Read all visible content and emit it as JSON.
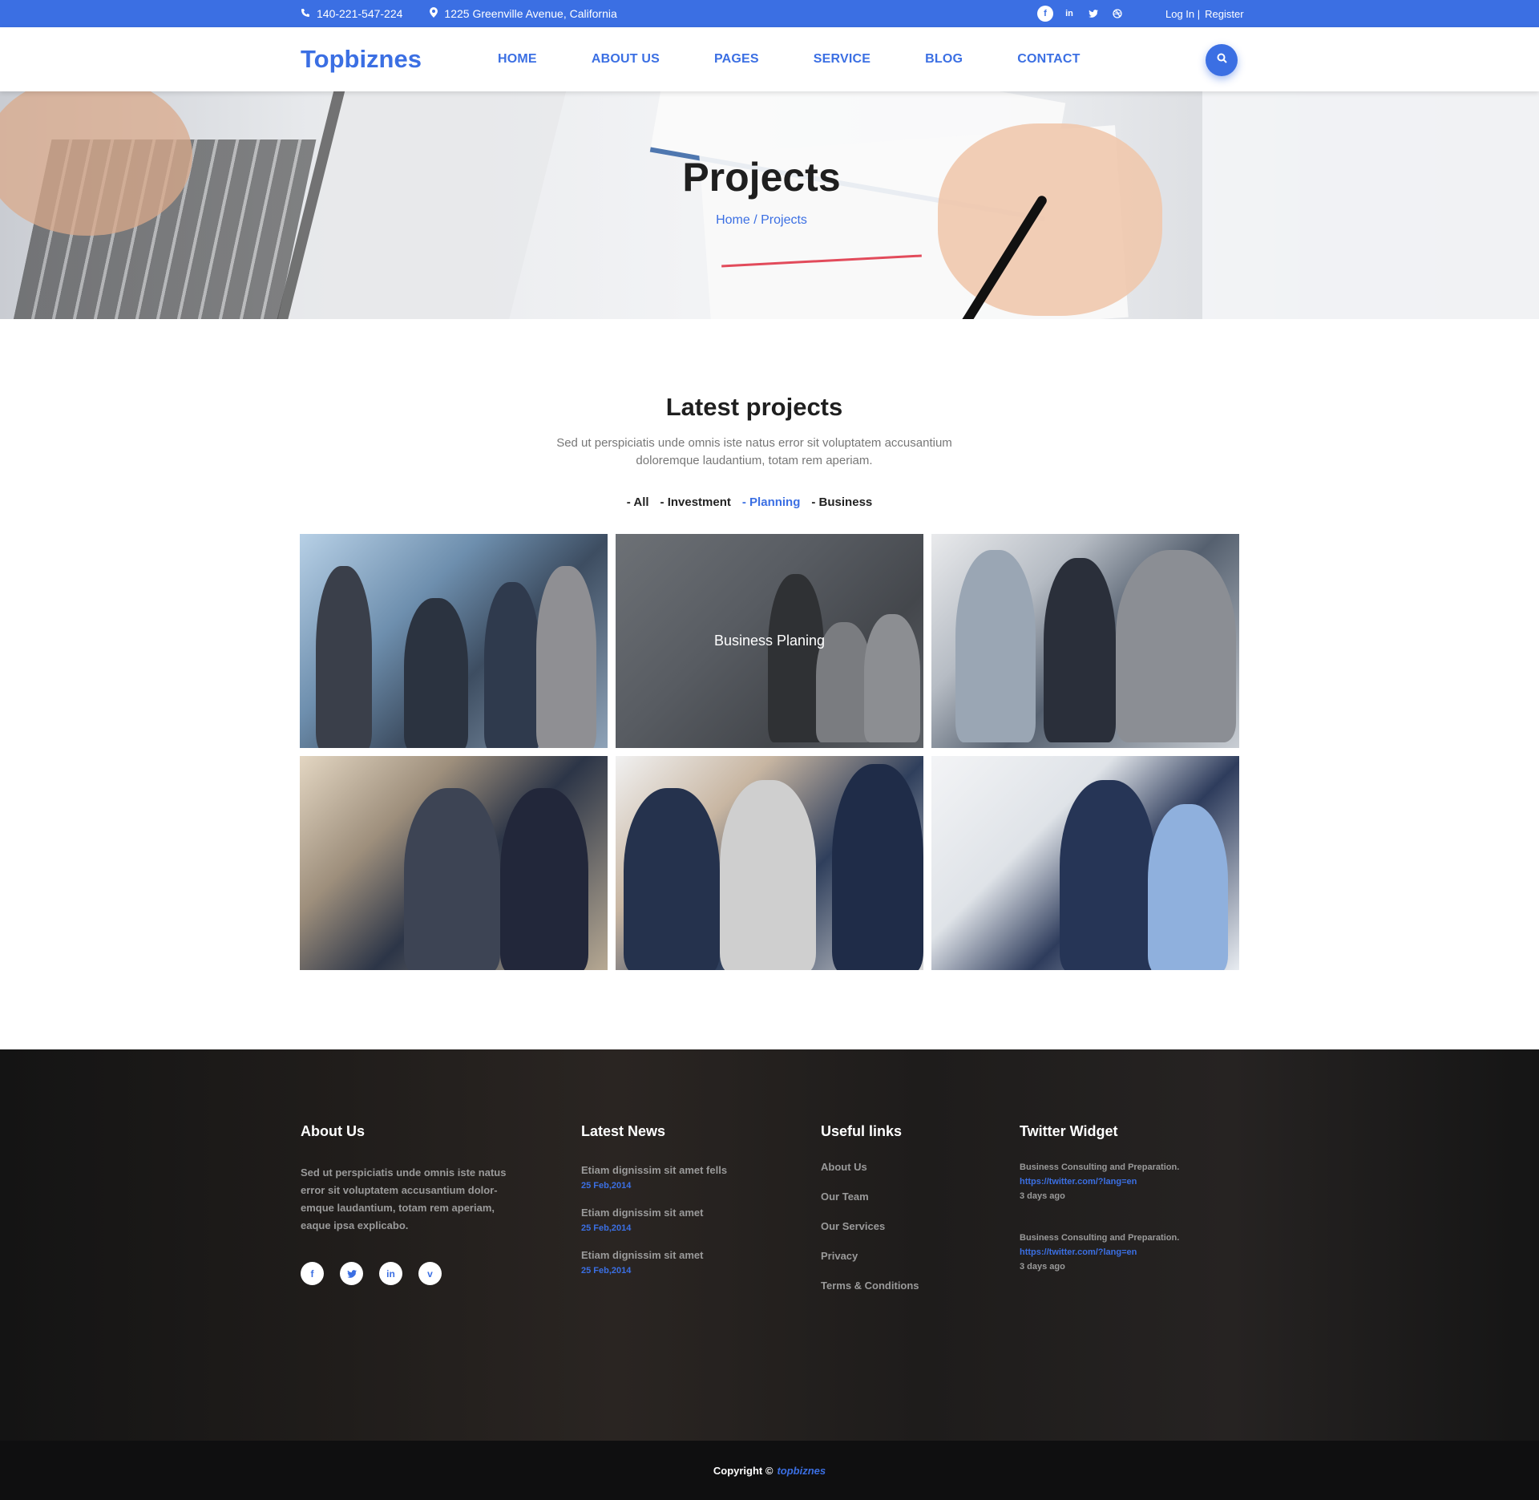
{
  "topbar": {
    "phone": "140-221-547-224",
    "address": "1225 Greenville Avenue, California",
    "social": [
      "facebook-icon",
      "linkedin-icon",
      "twitter-icon",
      "dribbble-icon"
    ],
    "login": "Log In |",
    "register": "Register"
  },
  "header": {
    "logo": "Topbiznes",
    "nav": [
      "HOME",
      "ABOUT US",
      "PAGES",
      "SERVICE",
      "BLOG",
      "CONTACT"
    ]
  },
  "hero": {
    "title": "Projects",
    "breadcrumb": "Home / Projects"
  },
  "projects": {
    "title": "Latest projects",
    "subtitle": "Sed ut perspiciatis unde omnis iste natus error sit voluptatem accusantium doloremque laudantium, totam rem aperiam.",
    "filters": [
      "- All",
      "- Investment",
      "- Planning",
      "- Business"
    ],
    "active_filter": "- Planning",
    "hover_caption": "Business Planing"
  },
  "footer": {
    "about": {
      "title": "About Us",
      "text": "Sed ut perspiciatis unde omnis iste natus error sit voluptatem accusantium dolor-emque laudantium, totam rem aperiam, eaque ipsa explicabo.",
      "social": [
        "f",
        "t",
        "in",
        "v"
      ]
    },
    "news": {
      "title": "Latest News",
      "items": [
        {
          "title": "Etiam dignissim sit amet fells",
          "date": "25 Feb,2014"
        },
        {
          "title": "Etiam dignissim sit amet",
          "date": "25 Feb,2014"
        },
        {
          "title": "Etiam dignissim sit amet",
          "date": "25 Feb,2014"
        }
      ]
    },
    "links": {
      "title": "Useful links",
      "items": [
        "About Us",
        "Our Team",
        "Our Services",
        "Privacy",
        "Terms & Conditions"
      ]
    },
    "twitter": {
      "title": "Twitter Widget",
      "items": [
        {
          "text": "Business Consulting and Preparation.",
          "url": "https://twitter.com/?lang=en",
          "ago": "3 days ago"
        },
        {
          "text": "Business Consulting and Preparation.",
          "url": "https://twitter.com/?lang=en",
          "ago": "3 days ago"
        }
      ]
    },
    "copyright_prefix": "Copyright ©",
    "copyright_brand": "topbiznes"
  },
  "colors": {
    "accent": "#3b6fe3",
    "footer_bg": "#1a1a1a"
  }
}
